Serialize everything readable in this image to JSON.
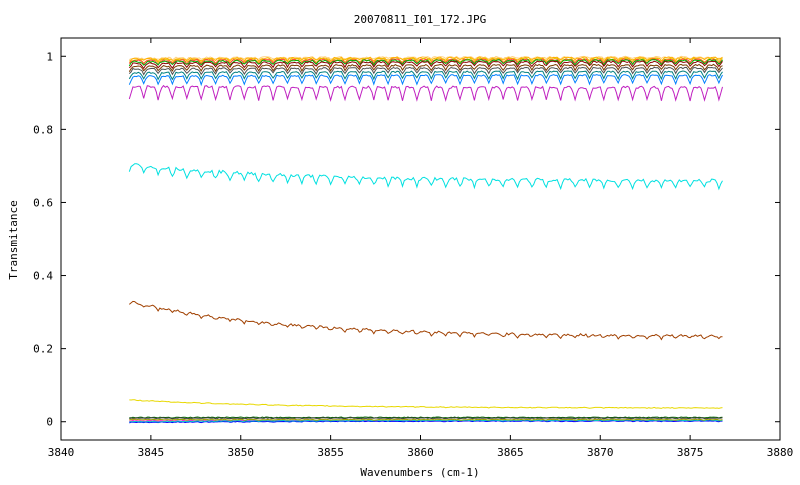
{
  "chart_data": {
    "type": "line",
    "title": "20070811_I01_172.JPG",
    "xlabel": "Wavenumbers (cm-1)",
    "ylabel": "Transmitance",
    "xlim": [
      3840,
      3880
    ],
    "ylim": [
      -0.05,
      1.05
    ],
    "x_ticks": [
      3840,
      3845,
      3850,
      3855,
      3860,
      3865,
      3870,
      3875,
      3880
    ],
    "x_tick_labels": [
      "3840",
      "3845",
      "3850",
      "3855",
      "3860",
      "3865",
      "3870",
      "3875",
      "3880"
    ],
    "y_ticks": [
      0,
      0.2,
      0.4,
      0.6,
      0.8,
      1
    ],
    "y_tick_labels": [
      "0",
      "0.2",
      "0.4",
      "0.6",
      "0.8",
      "1"
    ],
    "grid": false,
    "legend": "none",
    "x_range": [
      3843.8,
      3876.8
    ],
    "series": [
      {
        "color": "#ffd27f",
        "start": 0.995,
        "end": 0.998,
        "amp": 0.004,
        "noise": 0.002
      },
      {
        "color": "#ffb000",
        "start": 0.993,
        "end": 0.996,
        "amp": 0.006,
        "noise": 0.002
      },
      {
        "color": "#e8c000",
        "start": 0.99,
        "end": 0.993,
        "amp": 0.008,
        "noise": 0.002
      },
      {
        "color": "#ff4040",
        "start": 0.988,
        "end": 0.991,
        "amp": 0.009,
        "noise": 0.002
      },
      {
        "color": "#00b000",
        "start": 0.985,
        "end": 0.989,
        "amp": 0.01,
        "noise": 0.002
      },
      {
        "color": "#8b0000",
        "start": 0.98,
        "end": 0.985,
        "amp": 0.012,
        "noise": 0.002
      },
      {
        "color": "#7a3a00",
        "start": 0.972,
        "end": 0.976,
        "amp": 0.013,
        "noise": 0.002
      },
      {
        "color": "#505050",
        "start": 0.965,
        "end": 0.968,
        "amp": 0.014,
        "noise": 0.002
      },
      {
        "color": "#008080",
        "start": 0.955,
        "end": 0.958,
        "amp": 0.018,
        "noise": 0.002
      },
      {
        "color": "#0080ff",
        "start": 0.945,
        "end": 0.948,
        "amp": 0.022,
        "noise": 0.002
      },
      {
        "color": "#c020c0",
        "start": 0.918,
        "end": 0.915,
        "amp": 0.035,
        "noise": 0.003
      },
      {
        "color": "#00e0e0",
        "start": 0.705,
        "end": 0.66,
        "amp": 0.02,
        "noise": 0.004
      },
      {
        "color": "#a04000",
        "start": 0.33,
        "end": 0.235,
        "amp": 0.008,
        "noise": 0.003
      },
      {
        "color": "#e8d800",
        "start": 0.06,
        "end": 0.038,
        "amp": 0.001,
        "noise": 0.001
      },
      {
        "color": "#006400",
        "start": 0.012,
        "end": 0.012,
        "amp": 0.001,
        "noise": 0.001
      },
      {
        "color": "#404040",
        "start": 0.01,
        "end": 0.01,
        "amp": 0.001,
        "noise": 0.001
      },
      {
        "color": "#ff8080",
        "start": 0.005,
        "end": 0.004,
        "amp": 0.001,
        "noise": 0.001
      },
      {
        "color": "#ff00ff",
        "start": 0.002,
        "end": 0.003,
        "amp": 0.001,
        "noise": 0.001
      },
      {
        "color": "#0000ff",
        "start": -0.002,
        "end": 0.002,
        "amp": 0.001,
        "noise": 0.001
      },
      {
        "color": "#00c8c8",
        "start": 0.0,
        "end": 0.004,
        "amp": 0.001,
        "noise": 0.001
      },
      {
        "color": "#a0a000",
        "start": 0.006,
        "end": 0.006,
        "amp": 0.001,
        "noise": 0.001
      }
    ]
  }
}
